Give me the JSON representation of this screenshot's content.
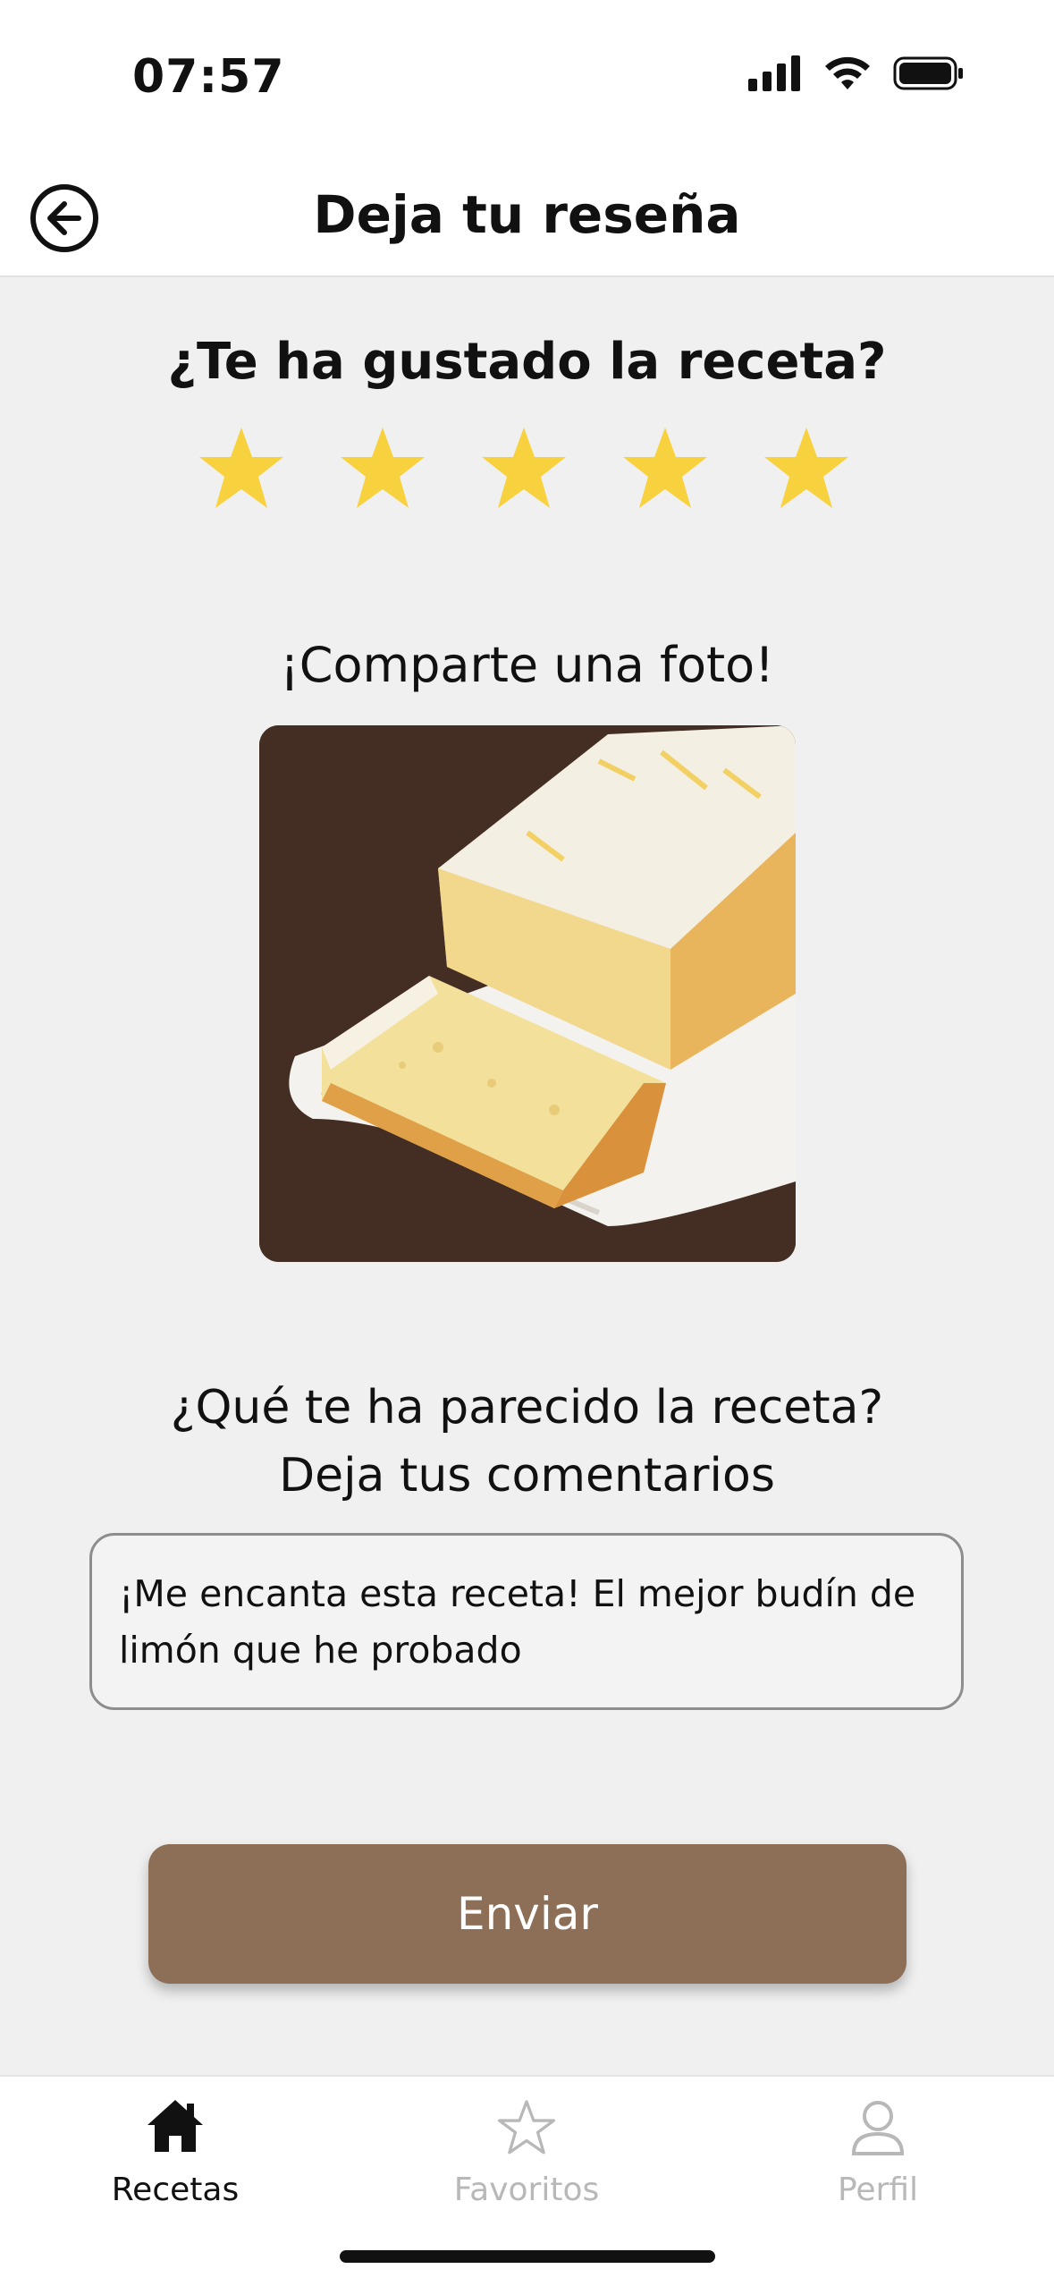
{
  "status_bar": {
    "time": "07:57"
  },
  "header": {
    "title": "Deja tu reseña"
  },
  "rating": {
    "question": "¿Te ha gustado la receta?",
    "value": 5,
    "max": 5,
    "star_color": "#f7d23e"
  },
  "photo": {
    "prompt": "¡Comparte una foto!"
  },
  "comment": {
    "question_line1": "¿Qué te ha parecido la receta?",
    "question_line2": "Deja tus comentarios",
    "value": "¡Me encanta esta receta! El mejor budín de limón que he probado"
  },
  "submit": {
    "label": "Enviar",
    "color": "#8d6e57"
  },
  "tabbar": {
    "items": [
      {
        "label": "Recetas",
        "icon": "home-icon",
        "active": true
      },
      {
        "label": "Favoritos",
        "icon": "star-outline-icon",
        "active": false
      },
      {
        "label": "Perfil",
        "icon": "person-icon",
        "active": false
      }
    ]
  }
}
